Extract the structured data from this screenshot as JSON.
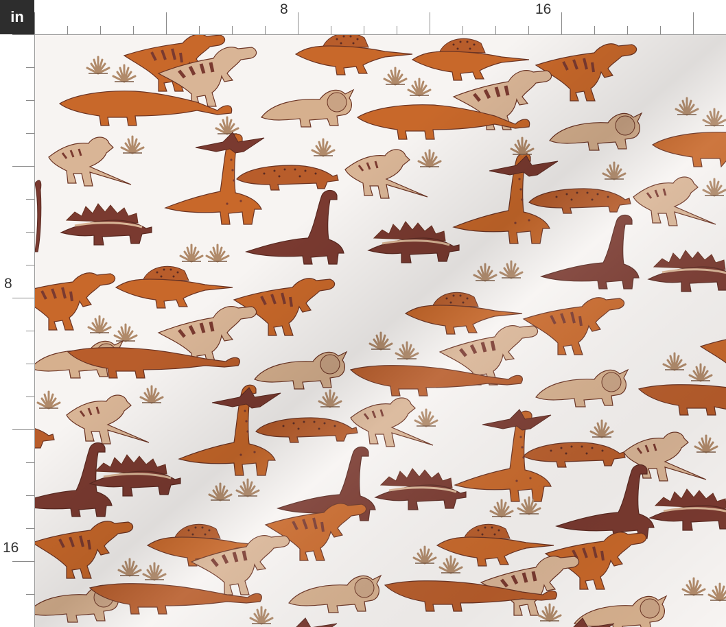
{
  "ruler": {
    "unit": "in",
    "top_labels": [
      "8",
      "16"
    ],
    "left_labels": [
      "8",
      "16"
    ]
  },
  "fabric": {
    "pattern": "dinosaurs",
    "background": "#f7f4f2",
    "colors": {
      "burnt_orange": "#c8682a",
      "rust": "#b85d2b",
      "tan": "#d9b596",
      "chocolate": "#7a3a30",
      "sand": "#d6b08e"
    },
    "motifs": [
      "t-rex",
      "triceratops",
      "brachiosaurus",
      "stegosaurus",
      "spinosaurus",
      "pterodactyl",
      "ankylosaurus",
      "apatosaurus",
      "pachycephalosaurus",
      "plant"
    ]
  }
}
